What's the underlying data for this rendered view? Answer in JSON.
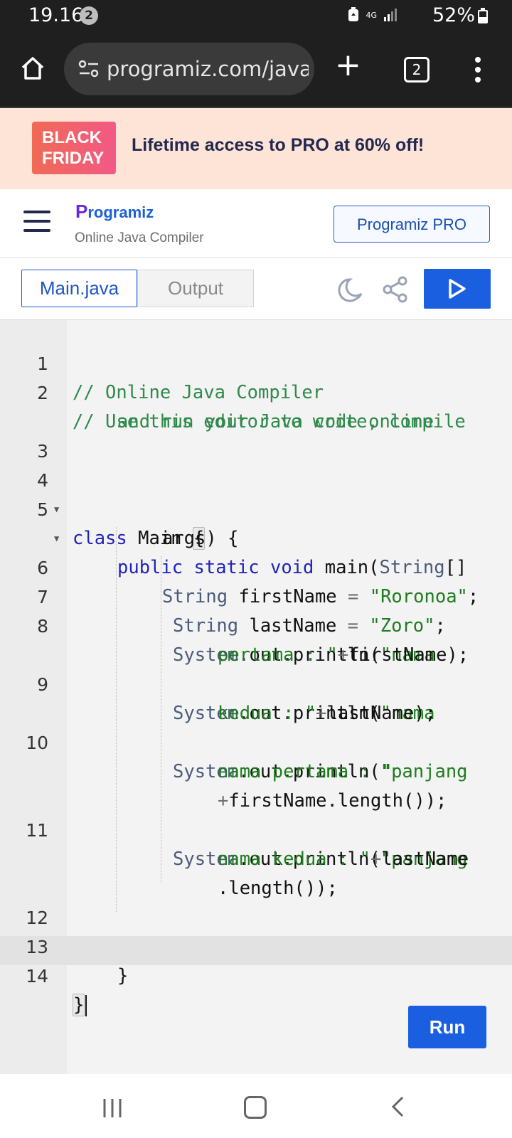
{
  "status_bar": {
    "time": "19.16",
    "notification_count": "2",
    "battery": "52%",
    "network": "4G"
  },
  "browser": {
    "url": "programiz.com/java-pr",
    "tab_count": "2",
    "icons": [
      "home-icon",
      "site-settings-icon",
      "plus-icon",
      "tabs-icon",
      "more-icon"
    ]
  },
  "promo": {
    "badge_line1": "BLACK",
    "badge_line2": "FRIDAY",
    "text": "Lifetime access to PRO at 60% off!"
  },
  "header": {
    "logo_text": "rogramiz",
    "logo_initial": "P",
    "subtitle": "Online Java Compiler",
    "pro_button": "Programiz PRO"
  },
  "toolbar": {
    "tab_main": "Main.java",
    "tab_output": "Output"
  },
  "code": {
    "line_numbers": [
      "1",
      "2",
      "3",
      "4",
      "5",
      "6",
      "7",
      "8",
      "9",
      "10",
      "11",
      "12",
      "13",
      "14"
    ],
    "l1": "// Online Java Compiler",
    "l2a": "// Use this editor to write, compile",
    "l2b": "and run your Java code online",
    "l4_kw": "class",
    "l4_name": " Main ",
    "l4_brace": "{",
    "l5_kw1": "public",
    "l5_kw2": "static",
    "l5_kw3": "void",
    "l5_fn": " main(",
    "l5_typ": "String",
    "l5_rest": "[]",
    "l5b": "args) {",
    "l6_typ": "String",
    "l6_var": " firstName ",
    "l6_op": "=",
    "l6_str": " \"Roronoa\"",
    "l6_end": ";",
    "l7_typ": "String",
    "l7_var": " lastName ",
    "l7_op": "=",
    "l7_str": " \"Zoro\"",
    "l7_end": ";",
    "sys": "System",
    "println": ".out.println(",
    "l8_str1": "\"nama",
    "l8_str2": "pertama : \"",
    "l8_rest": "firstName);",
    "l9_str1": "\"nama",
    "l9_str2": "kedua : \"",
    "l9_rest": "lastName);",
    "l10_str1": "\"panjang",
    "l10_str2": "nama pertama : \"",
    "l10_rest": "firstName.length());",
    "l11_str1": "\"panjang",
    "l11_str2": "nama kedua : \"",
    "l11_rest": "lastName",
    "l11_rest2": ".length());",
    "plus": "+",
    "l13": "}",
    "l14": "}"
  },
  "run_button": "Run"
}
